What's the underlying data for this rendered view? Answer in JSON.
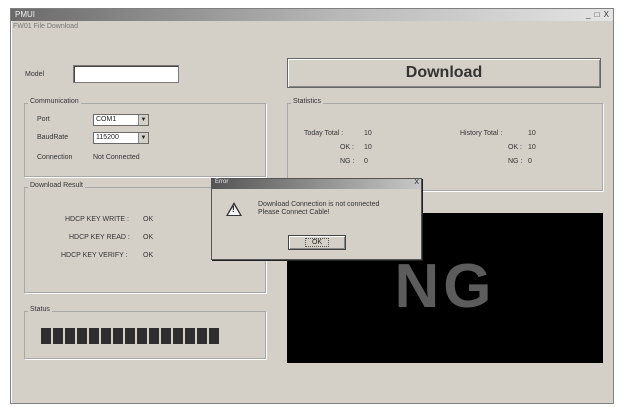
{
  "window": {
    "title": "PMUI",
    "menu": "FW01  File  Download",
    "controls": "_ □ X"
  },
  "model": {
    "label": "Model",
    "value": ""
  },
  "download_button": {
    "label": "Download"
  },
  "communication": {
    "title": "Communication",
    "port_label": "Port",
    "port_value": "COM1",
    "baud_label": "BaudRate",
    "baud_value": "115200",
    "connection_label": "Connection",
    "connection_value": "Not Connected"
  },
  "statistics": {
    "title": "Statistics",
    "today_total_label": "Today Total :",
    "today_total": "10",
    "today_ok_label": "OK :",
    "today_ok": "10",
    "today_ng_label": "NG :",
    "today_ng": "0",
    "history_total_label": "History Total :",
    "history_total": "10",
    "history_ok_label": "OK :",
    "history_ok": "10",
    "history_ng_label": "NG :",
    "history_ng": "0"
  },
  "download_result": {
    "title": "Download Result",
    "write_label": "HDCP KEY WRITE :",
    "write_value": "OK",
    "read_label": "HDCP KEY READ :",
    "read_value": "OK",
    "verify_label": "HDCP KEY VERIFY :",
    "verify_value": "OK"
  },
  "status": {
    "title": "Status",
    "progress": 1.0,
    "segments": 15
  },
  "result_display": {
    "text": "NG"
  },
  "dialog": {
    "title": "Error",
    "close": "X",
    "message_line1": "Download Connection is not connected",
    "message_line2": "Please Connect Cable!",
    "ok_label": "OK"
  }
}
